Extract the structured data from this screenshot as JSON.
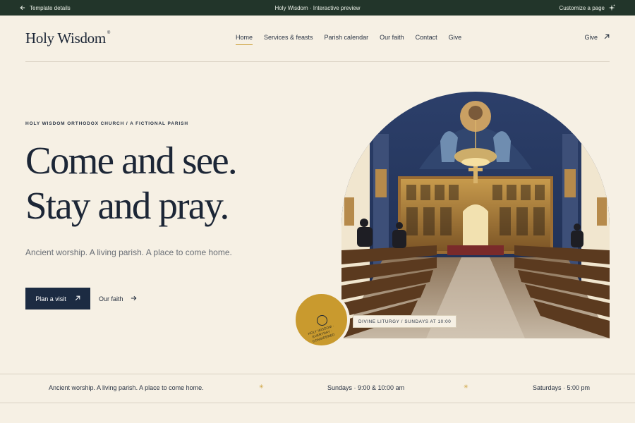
{
  "topbar": {
    "back_label": "Template details",
    "preview_label": "Holy Wisdom · Interactive preview",
    "customize_label": "Customize a page"
  },
  "nav": {
    "logo": "Holy Wisdom",
    "logo_mark": "®",
    "items": [
      {
        "label": "Home",
        "active": true
      },
      {
        "label": "Services & feasts",
        "active": false
      },
      {
        "label": "Parish calendar",
        "active": false
      },
      {
        "label": "Our faith",
        "active": false
      },
      {
        "label": "Contact",
        "active": false
      },
      {
        "label": "Give",
        "active": false
      }
    ],
    "give_label": "Give"
  },
  "hero": {
    "eyebrow": "HOLY WISDOM ORTHODOX CHURCH / A FICTIONAL PARISH",
    "headline_1": "Come and see.",
    "headline_2": "Stay and pray.",
    "subtitle": "Ancient worship. A living parish. A place to come home.",
    "primary_button": "Plan a visit",
    "secondary_link": "Our faith",
    "badge_text": "HOLY WISDOM · EVERYDAY · CONSIDERED",
    "caption": "DIVINE LITURGY / SUNDAYS AT 10:00"
  },
  "strip": {
    "tagline": "Ancient worship. A living parish. A place to come home.",
    "sundays": "Sundays · 9:00 & 10:00 am",
    "saturdays": "Saturdays · 5:00 pm",
    "separator": "✳"
  },
  "colors": {
    "background": "#f6f0e4",
    "topbar": "#22352a",
    "navy": "#1c2b42",
    "gold": "#c99a2e"
  }
}
